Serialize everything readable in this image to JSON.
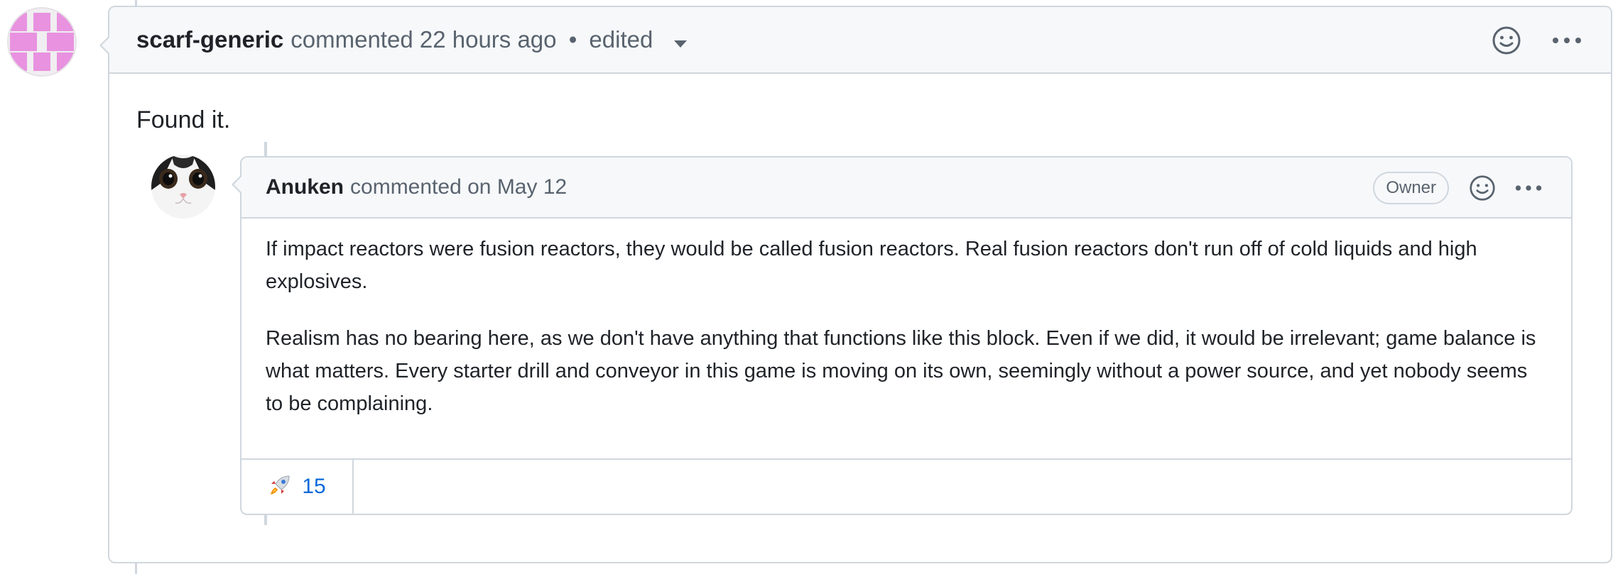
{
  "outer_comment": {
    "author": "scarf-generic",
    "action": "commented",
    "time": "22 hours ago",
    "separator": "•",
    "edited": "edited",
    "body": "Found it."
  },
  "quoted_comment": {
    "author": "Anuken",
    "action": "commented on",
    "date": "May 12",
    "badge": "Owner",
    "paragraphs": [
      "If impact reactors were fusion reactors, they would be called fusion reactors. Real fusion reactors don't run off of cold liquids and high explosives.",
      "Realism has no bearing here, as we don't have anything that functions like this block. Even if we did, it would be irrelevant; game balance is what matters. Every starter drill and conveyor in this game is moving on its own, seemingly without a power source, and yet nobody seems to be complaining."
    ],
    "reactions": [
      {
        "icon": "rocket-icon",
        "count": "15"
      }
    ]
  },
  "colors": {
    "border": "#d0d7de",
    "header_bg": "#f6f8fa",
    "muted_text": "#59636e",
    "link_blue": "#0969da",
    "identicon": "#e892e0"
  }
}
